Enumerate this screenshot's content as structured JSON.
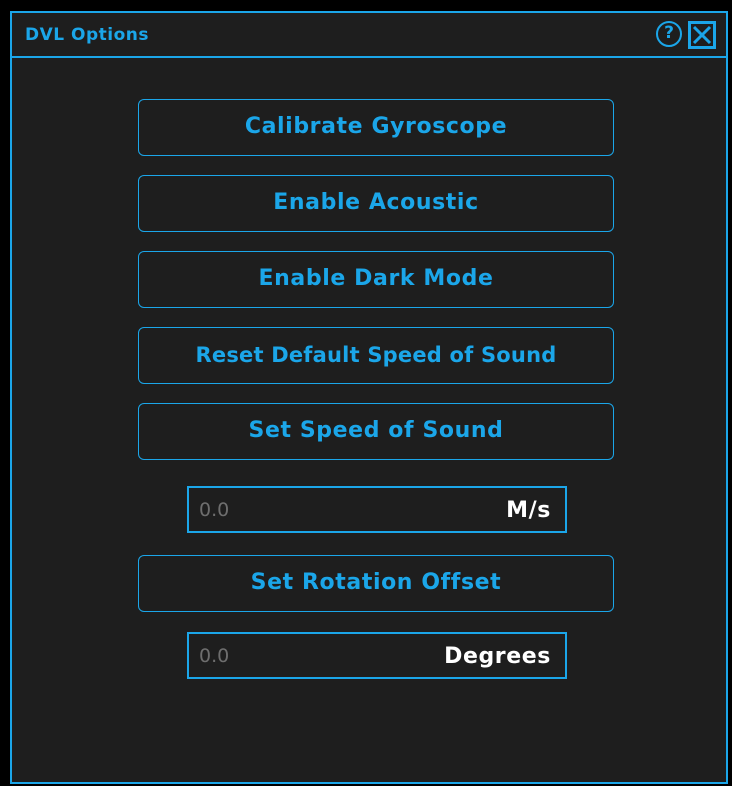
{
  "window": {
    "title": "DVL Options",
    "help_glyph": "?",
    "help_icon": "help-icon",
    "close_icon": "close-icon"
  },
  "buttons": {
    "calibrate_gyroscope": "Calibrate Gyroscope",
    "enable_acoustic": "Enable Acoustic",
    "enable_dark_mode": "Enable Dark Mode",
    "reset_default_speed_of_sound": "Reset Default Speed of Sound",
    "set_speed_of_sound": "Set Speed of Sound",
    "set_rotation_offset": "Set Rotation Offset"
  },
  "speed_of_sound_field": {
    "value": "",
    "placeholder": "0.0",
    "unit": "M/s"
  },
  "rotation_offset_field": {
    "value": "",
    "placeholder": "0.0",
    "unit": "Degrees"
  },
  "colors": {
    "accent": "#1ba6e9",
    "background": "#1e1e1e",
    "placeholder_text": "#6e6e6e",
    "unit_text": "#ffffff"
  }
}
